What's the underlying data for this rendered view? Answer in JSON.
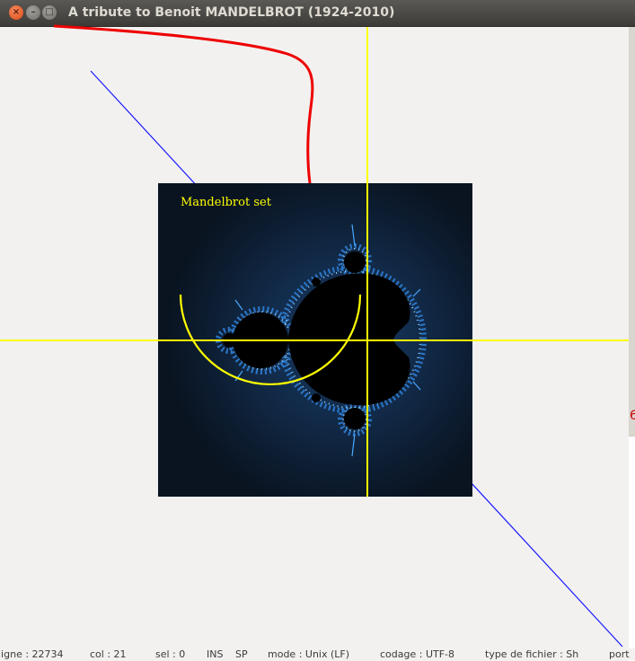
{
  "window": {
    "title": "A tribute to Benoit MANDELBROT (1924-2010)",
    "buttons": {
      "close": "×",
      "minimize": "–",
      "maximize": "□"
    }
  },
  "figure": {
    "label": "Mandelbrot set",
    "label_color": "#ffff00",
    "background": "#0a1421",
    "set_color": "#000000",
    "axis_color": "#ffff00",
    "curve_color": "#ee0000",
    "line_color": "#1a1aff"
  },
  "background_editor": {
    "partial_text": "6",
    "status": [
      "ligne : 22734",
      "col : 21",
      "sel : 0",
      "INS",
      "SP",
      "mode : Unix (LF)",
      "codage : UTF-8",
      "type de fichier : Sh",
      "port"
    ]
  }
}
